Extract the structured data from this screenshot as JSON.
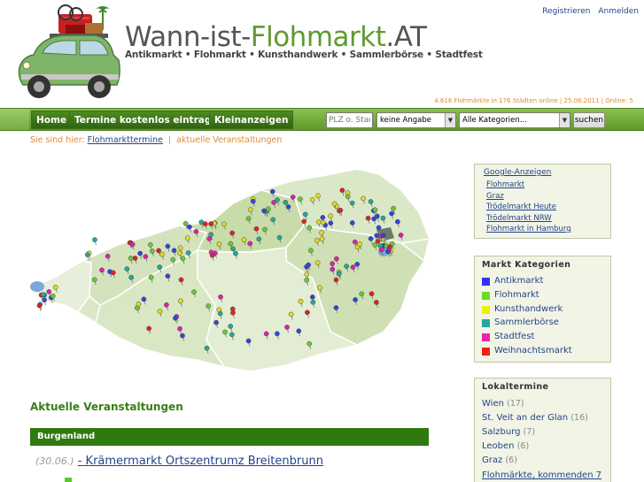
{
  "header": {
    "logo_text_1": "Wann-ist-",
    "logo_text_2": "Flohmarkt",
    "logo_text_3": ".AT",
    "tagline": "Antikmarkt • Flohmarkt • Kunsthandwerk • Sammlerbörse • Stadtfest",
    "register_label": "Registrieren",
    "login_label": "Anmelden",
    "stats_text": "4.616 Flohmärkte in 176 Städten online | 25.06.2011 | Online: 5"
  },
  "nav": {
    "home_label": "Home",
    "add_label": "Termine kostenlos eintragen",
    "ads_label": "Kleinanzeigen",
    "search_placeholder": "PLZ o. Stadt",
    "select_1_value": "keine Angabe",
    "select_2_value": "Alle Kategorien...",
    "submit_label": "suchen"
  },
  "breadcrumb": {
    "prefix": "Sie sind hier:",
    "link": "Flohmarkttermine",
    "current": "aktuelle Veranstaltungen"
  },
  "map": {
    "pin_colors": [
      "#3344dd",
      "#66cc33",
      "#dddd22",
      "#22aa99",
      "#dd22aa",
      "#dd2222"
    ]
  },
  "content": {
    "section_title": "Aktuelle Veranstaltungen",
    "region": "Burgenland",
    "event_date": "(30.06.)",
    "event_title": "- Krämermarkt Ortszentrumz Breitenbrunn"
  },
  "sidebar": {
    "ads_heading": "Google-Anzeigen",
    "ads": [
      "Flohmarkt",
      "Graz",
      "Trödelmarkt Heute",
      "Trödelmarkt NRW",
      "Flohmarkt in Hamburg"
    ],
    "categories_title": "Markt Kategorien",
    "categories": [
      {
        "label": "Antikmarkt",
        "color": "#3333ee"
      },
      {
        "label": "Flohmarkt",
        "color": "#66dd22"
      },
      {
        "label": "Kunsthandwerk",
        "color": "#eeee11"
      },
      {
        "label": "Sammlerbörse",
        "color": "#22aa99"
      },
      {
        "label": "Stadtfest",
        "color": "#ee22aa"
      },
      {
        "label": "Weihnachtsmarkt",
        "color": "#ee2211"
      }
    ],
    "local_title": "Lokaltermine",
    "local": [
      {
        "city": "Wien",
        "count": "(17)"
      },
      {
        "city": "St. Veit an der Glan",
        "count": "(16)"
      },
      {
        "city": "Salzburg",
        "count": "(7)"
      },
      {
        "city": "Leoben",
        "count": "(6)"
      },
      {
        "city": "Graz",
        "count": "(6)"
      }
    ],
    "local_more": "Flohmärkte, kommenden 7"
  }
}
